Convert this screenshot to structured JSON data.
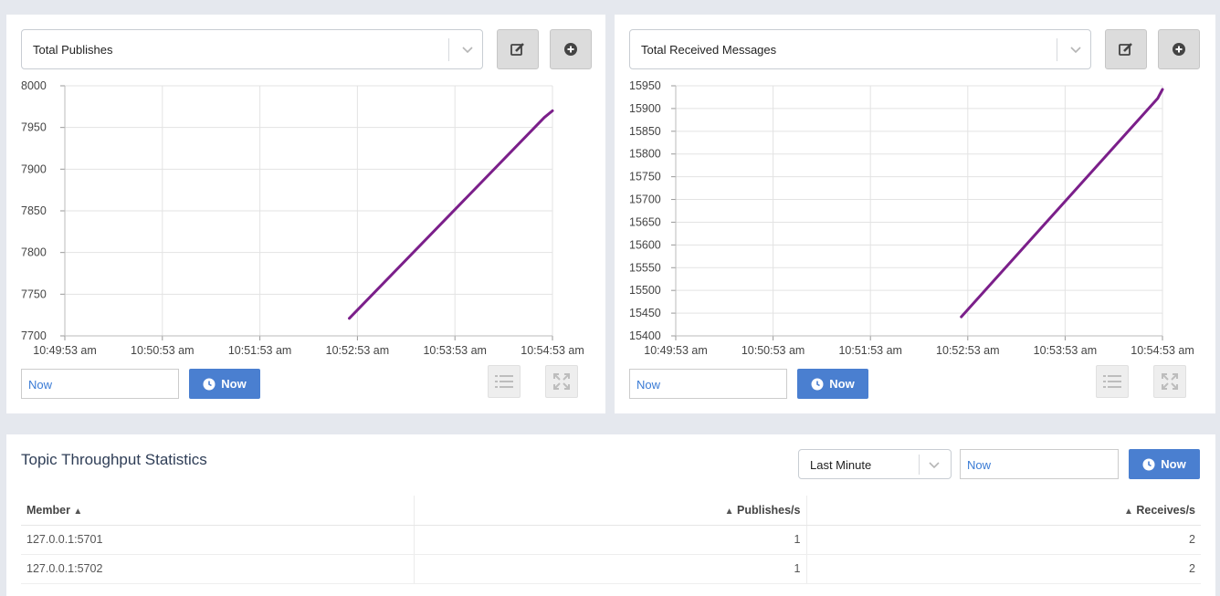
{
  "charts": [
    {
      "selected_metric": "Total Publishes",
      "now_input": "Now",
      "now_button": "Now",
      "chart_data": {
        "type": "line",
        "title": "",
        "xlabel": "",
        "ylabel": "",
        "x_ticks": [
          "10:49:53 am",
          "10:50:53 am",
          "10:51:53 am",
          "10:52:53 am",
          "10:53:53 am",
          "10:54:53 am"
        ],
        "y_ticks": [
          7700,
          7750,
          7800,
          7850,
          7900,
          7950,
          8000
        ],
        "ylim": [
          7700,
          8000
        ],
        "xlim_seconds": [
          0,
          300
        ],
        "series": [
          {
            "color": "#7b1f8a",
            "points": [
              [
                175,
                7721
              ],
              [
                295,
                7962
              ],
              [
                300,
                7970
              ]
            ]
          }
        ],
        "grid": true
      }
    },
    {
      "selected_metric": "Total Received Messages",
      "now_input": "Now",
      "now_button": "Now",
      "chart_data": {
        "type": "line",
        "title": "",
        "xlabel": "",
        "ylabel": "",
        "x_ticks": [
          "10:49:53 am",
          "10:50:53 am",
          "10:51:53 am",
          "10:52:53 am",
          "10:53:53 am",
          "10:54:53 am"
        ],
        "y_ticks": [
          15400,
          15450,
          15500,
          15550,
          15600,
          15650,
          15700,
          15750,
          15800,
          15850,
          15900,
          15950
        ],
        "ylim": [
          15400,
          15950
        ],
        "xlim_seconds": [
          0,
          300
        ],
        "series": [
          {
            "color": "#7b1f8a",
            "points": [
              [
                176,
                15442
              ],
              [
                297,
                15922
              ],
              [
                300,
                15942
              ]
            ]
          }
        ],
        "grid": true
      }
    }
  ],
  "stats": {
    "title": "Topic Throughput Statistics",
    "range_select": "Last Minute",
    "now_input": "Now",
    "now_button": "Now",
    "columns": [
      "Member",
      "Publishes/s",
      "Receives/s"
    ],
    "rows": [
      {
        "member": "127.0.0.1:5701",
        "publishes": "1",
        "receives": "2"
      },
      {
        "member": "127.0.0.1:5702",
        "publishes": "1",
        "receives": "2"
      }
    ]
  },
  "colors": {
    "accent": "#4a7fd0",
    "line": "#7b1f8a",
    "grid": "#e3e3e3"
  },
  "icons": [
    "chevron-down-icon",
    "edit-icon",
    "plus-circle-icon",
    "clock-icon",
    "list-icon",
    "expand-icon",
    "sort-icon"
  ]
}
